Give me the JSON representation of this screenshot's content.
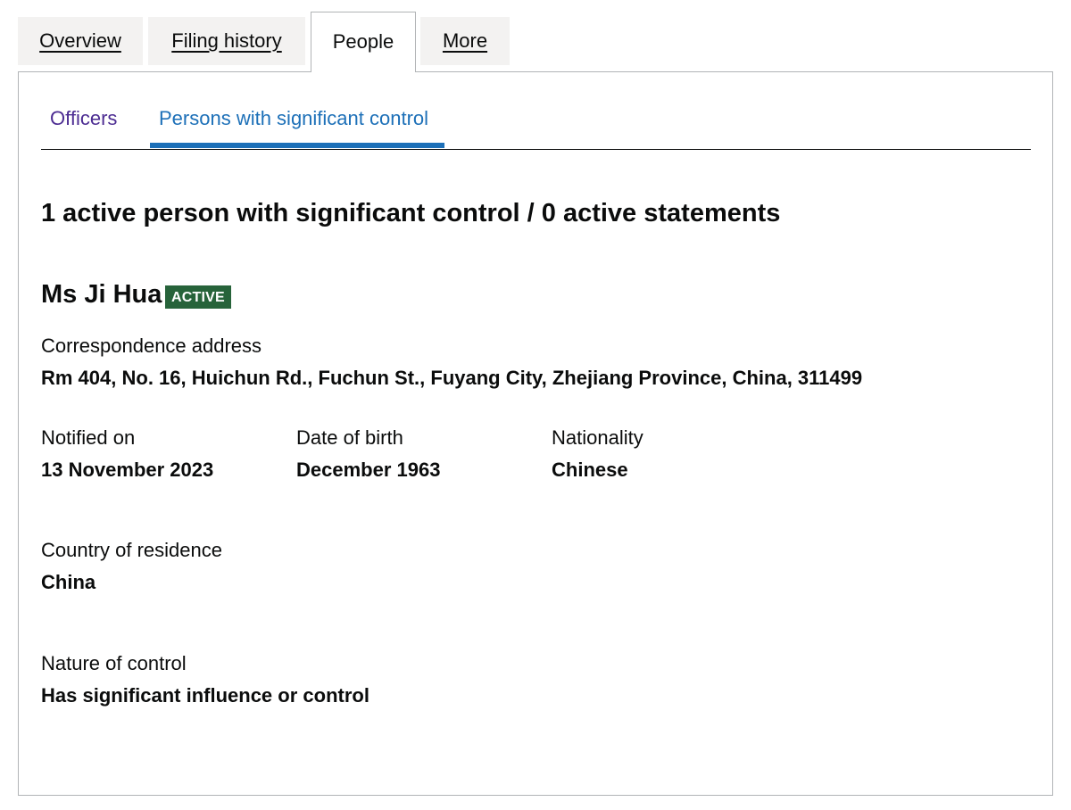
{
  "tabs": {
    "overview": "Overview",
    "filing_history": "Filing history",
    "people": "People",
    "more": "More"
  },
  "subtabs": {
    "officers": "Officers",
    "psc": "Persons with significant control"
  },
  "heading": "1 active person with significant control / 0 active statements",
  "person": {
    "name": "Ms Ji Hua",
    "status": "ACTIVE",
    "correspondence_label": "Correspondence address",
    "correspondence_value": "Rm 404, No. 16, Huichun Rd., Fuchun St., Fuyang City, Zhejiang Province, China, 311499",
    "notified_label": "Notified on",
    "notified_value": "13 November 2023",
    "dob_label": "Date of birth",
    "dob_value": "December 1963",
    "nationality_label": "Nationality",
    "nationality_value": "Chinese",
    "residence_label": "Country of residence",
    "residence_value": "China",
    "nature_label": "Nature of control",
    "nature_value": "Has significant influence or control"
  },
  "colors": {
    "link_visited": "#4c2c92",
    "link": "#1d70b8",
    "status_badge": "#27633a",
    "tab_background": "#f3f2f1",
    "border": "#b1b4b6"
  }
}
